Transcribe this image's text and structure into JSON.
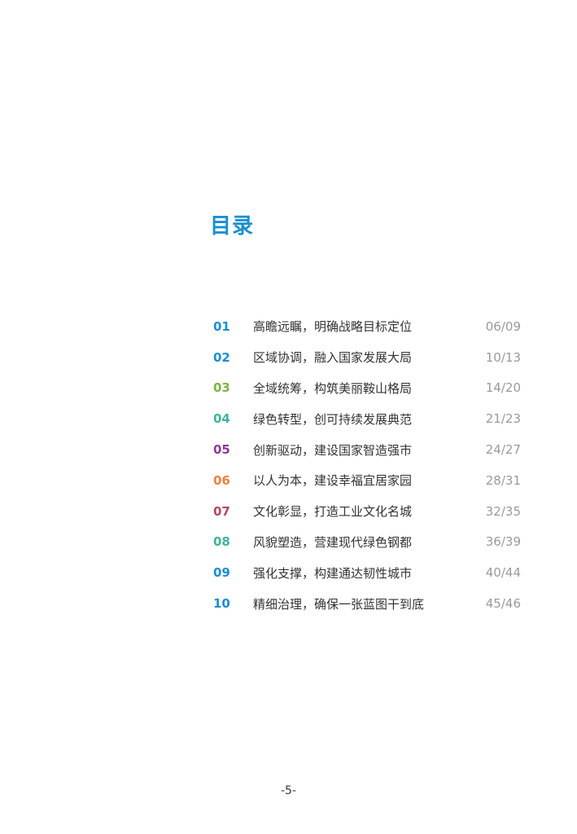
{
  "title": "目录",
  "colors": {
    "title": "#1a8fd0"
  },
  "items": [
    {
      "num": "01",
      "text": "高瞻远瞩，明确战略目标定位",
      "pages": "06/09",
      "color": "#1a8fd0"
    },
    {
      "num": "02",
      "text": "区域协调，融入国家发展大局",
      "pages": "10/13",
      "color": "#1a8fd0"
    },
    {
      "num": "03",
      "text": "全域统筹，构筑美丽鞍山格局",
      "pages": "14/20",
      "color": "#7cb342"
    },
    {
      "num": "04",
      "text": "绿色转型，创可持续发展典范",
      "pages": "21/23",
      "color": "#3fb39a"
    },
    {
      "num": "05",
      "text": "创新驱动，建设国家智造强市",
      "pages": "24/27",
      "color": "#8e3a92"
    },
    {
      "num": "06",
      "text": "以人为本，建设幸福宜居家园",
      "pages": "28/31",
      "color": "#f07f3c"
    },
    {
      "num": "07",
      "text": "文化彰显，打造工业文化名城",
      "pages": "32/35",
      "color": "#b04a5a"
    },
    {
      "num": "08",
      "text": "风貌塑造，营建现代绿色钢都",
      "pages": "36/39",
      "color": "#3fb39a"
    },
    {
      "num": "09",
      "text": "强化支撑，构建通达韧性城市",
      "pages": "40/44",
      "color": "#1a8fd0"
    },
    {
      "num": "10",
      "text": "精细治理，确保一张蓝图干到底",
      "pages": "45/46",
      "color": "#1a8fd0"
    }
  ],
  "page_number": "-5-"
}
